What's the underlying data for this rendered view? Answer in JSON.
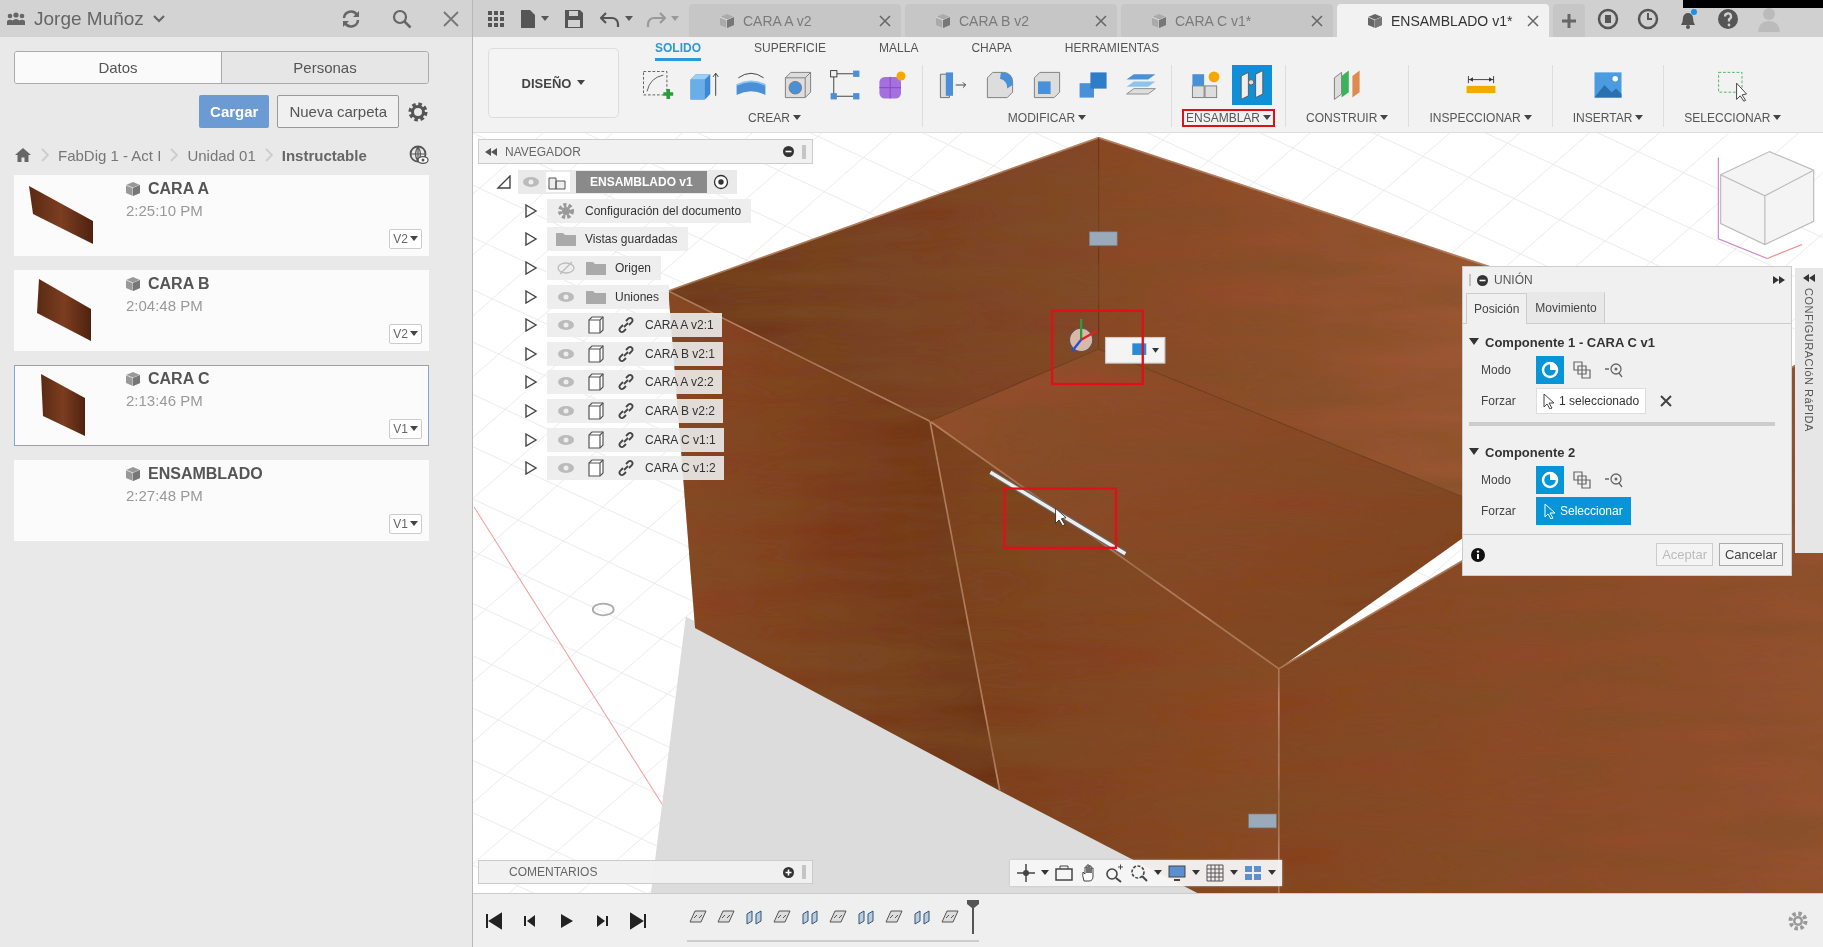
{
  "left_panel": {
    "user": "Jorge Muñoz",
    "tabs": [
      {
        "label": "Datos",
        "selected": true
      },
      {
        "label": "Personas",
        "selected": false
      }
    ],
    "upload_button": "Cargar",
    "new_folder_button": "Nueva carpeta",
    "breadcrumb": [
      "FabDig 1 - Act I",
      "Unidad 01",
      "Instructable"
    ],
    "files": [
      {
        "name": "CARA A",
        "time": "2:25:10 PM",
        "version": "V2",
        "thumbnail": true,
        "selected": false
      },
      {
        "name": "CARA B",
        "time": "2:04:48 PM",
        "version": "V2",
        "thumbnail": true,
        "selected": false
      },
      {
        "name": "CARA C",
        "time": "2:13:46 PM",
        "version": "V1",
        "thumbnail": true,
        "selected": true
      },
      {
        "name": "ENSAMBLADO",
        "time": "2:27:48 PM",
        "version": "V1",
        "thumbnail": false,
        "selected": false
      }
    ]
  },
  "document_tabs": [
    {
      "label": "CARA A v2",
      "selected": false
    },
    {
      "label": "CARA B v2",
      "selected": false
    },
    {
      "label": "CARA C v1*",
      "selected": false
    },
    {
      "label": "ENSAMBLADO v1*",
      "selected": true
    }
  ],
  "toolbar": {
    "workspace": "DISEÑO",
    "tabs": [
      {
        "label": "SOLIDO",
        "selected": true
      },
      {
        "label": "SUPERFICIE",
        "selected": false
      },
      {
        "label": "MALLA",
        "selected": false
      },
      {
        "label": "CHAPA",
        "selected": false
      },
      {
        "label": "HERRAMIENTAS",
        "selected": false
      }
    ],
    "groups": [
      {
        "label": "CREAR",
        "highlighted": false,
        "tools": [
          {
            "kind": "sketch",
            "active": false
          },
          {
            "kind": "extrude",
            "active": false
          },
          {
            "kind": "revolve",
            "active": false
          },
          {
            "kind": "hole",
            "active": false
          },
          {
            "kind": "pattern",
            "active": false
          },
          {
            "kind": "form",
            "active": false
          }
        ]
      },
      {
        "label": "MODIFICAR",
        "highlighted": false,
        "tools": [
          {
            "kind": "presspull",
            "active": false
          },
          {
            "kind": "fillet",
            "active": false
          },
          {
            "kind": "shell",
            "active": false
          },
          {
            "kind": "combine",
            "active": false
          },
          {
            "kind": "offset",
            "active": false
          }
        ]
      },
      {
        "label": "ENSAMBLAR",
        "highlighted": true,
        "tools": [
          {
            "kind": "new_component",
            "active": false
          },
          {
            "kind": "joint",
            "active": true
          }
        ]
      },
      {
        "label": "CONSTRUIR",
        "highlighted": false,
        "tools": [
          {
            "kind": "construct",
            "active": false
          }
        ]
      },
      {
        "label": "INSPECCIONAR",
        "highlighted": false,
        "tools": [
          {
            "kind": "measure",
            "active": false
          }
        ]
      },
      {
        "label": "INSERTAR",
        "highlighted": false,
        "tools": [
          {
            "kind": "insert",
            "active": false
          }
        ]
      },
      {
        "label": "SELECCIONAR",
        "highlighted": false,
        "tools": [
          {
            "kind": "select",
            "active": false
          }
        ]
      }
    ]
  },
  "navigator": {
    "title": "NAVEGADOR",
    "root": {
      "label": "ENSAMBLADO v1",
      "expanded": true,
      "visible": true,
      "children": [
        {
          "label": "Configuración del documento",
          "kind": "settings",
          "expanded": false
        },
        {
          "label": "Vistas guardadas",
          "kind": "folder",
          "expanded": false
        },
        {
          "label": "Origen",
          "kind": "toggle_folder",
          "expanded": false,
          "visible": false
        },
        {
          "label": "Uniones",
          "kind": "toggle_folder",
          "expanded": false,
          "visible": true
        },
        {
          "label": "CARA A v2:1",
          "kind": "component",
          "expanded": false,
          "visible": true
        },
        {
          "label": "CARA B v2:1",
          "kind": "component",
          "expanded": false,
          "visible": true
        },
        {
          "label": "CARA A v2:2",
          "kind": "component",
          "expanded": false,
          "visible": true
        },
        {
          "label": "CARA B v2:2",
          "kind": "component",
          "expanded": false,
          "visible": true
        },
        {
          "label": "CARA C v1:1",
          "kind": "component",
          "expanded": false,
          "visible": true
        },
        {
          "label": "CARA C v1:2",
          "kind": "component",
          "expanded": false,
          "visible": true
        }
      ]
    }
  },
  "comments": {
    "title": "COMENTARIOS"
  },
  "joint_panel": {
    "title": "UNIÓN",
    "tabs": [
      {
        "label": "Posición",
        "selected": true
      },
      {
        "label": "Movimiento",
        "selected": false
      }
    ],
    "sections": [
      {
        "title": "Componente 1 - CARA C v1",
        "expanded": true,
        "mode_label": "Modo",
        "modes": [
          {
            "kind": "simple",
            "selected": true
          },
          {
            "kind": "between",
            "selected": false
          },
          {
            "kind": "center",
            "selected": false
          }
        ],
        "snap_label": "Forzar",
        "kind": "selected",
        "snap_value": "1 seleccionado"
      },
      {
        "title": "Componente 2",
        "expanded": true,
        "mode_label": "Modo",
        "modes": [
          {
            "kind": "simple",
            "selected": true
          },
          {
            "kind": "between",
            "selected": false
          },
          {
            "kind": "center",
            "selected": false
          }
        ],
        "snap_label": "Forzar",
        "kind": "picking",
        "snap_value": "Seleccionar"
      }
    ],
    "ok_button": {
      "label": "Aceptar",
      "disabled": true
    },
    "cancel_button": "Cancelar"
  },
  "quick_settings": {
    "title": "CONFIGURACIóN RáPIDA"
  },
  "timeline": {
    "features": [
      {
        "kind": "rigid"
      },
      {
        "kind": "rigid"
      },
      {
        "kind": "hinge"
      },
      {
        "kind": "rigid"
      },
      {
        "kind": "hinge"
      },
      {
        "kind": "rigid"
      },
      {
        "kind": "hinge"
      },
      {
        "kind": "rigid"
      },
      {
        "kind": "hinge"
      },
      {
        "kind": "rigid"
      }
    ]
  }
}
